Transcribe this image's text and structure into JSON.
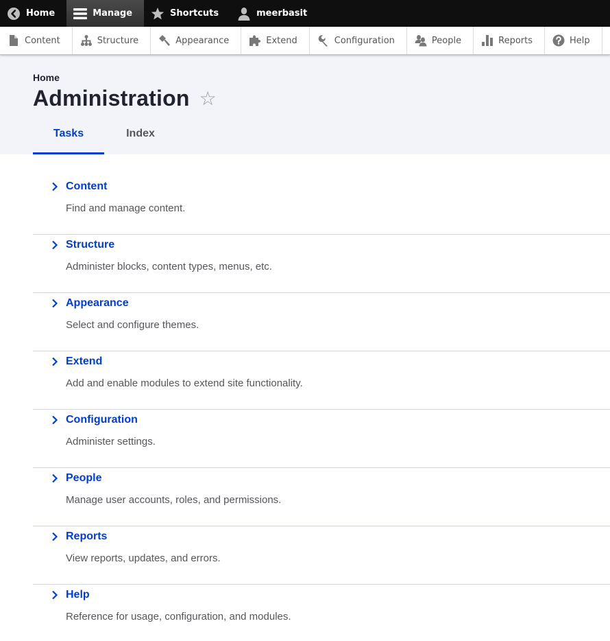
{
  "toolbar": {
    "items": [
      {
        "label": "Home",
        "icon": "back-arrow-circle-icon"
      },
      {
        "label": "Manage",
        "icon": "hamburger-menu-icon",
        "active": true
      },
      {
        "label": "Shortcuts",
        "icon": "star-icon"
      },
      {
        "label": "meerbasit",
        "icon": "user-icon"
      }
    ]
  },
  "tray": {
    "items": [
      {
        "label": "Content",
        "icon": "file-icon"
      },
      {
        "label": "Structure",
        "icon": "sitemap-icon"
      },
      {
        "label": "Appearance",
        "icon": "paintbrush-icon"
      },
      {
        "label": "Extend",
        "icon": "puzzle-icon"
      },
      {
        "label": "Configuration",
        "icon": "wrench-icon"
      },
      {
        "label": "People",
        "icon": "people-icon"
      },
      {
        "label": "Reports",
        "icon": "bar-chart-icon"
      },
      {
        "label": "Help",
        "icon": "question-circle-icon"
      }
    ]
  },
  "header": {
    "breadcrumb": "Home",
    "title": "Administration",
    "star_icon": "☆",
    "tabs": [
      {
        "label": "Tasks",
        "active": true
      },
      {
        "label": "Index",
        "active": false
      }
    ]
  },
  "tasks": [
    {
      "title": "Content",
      "description": "Find and manage content."
    },
    {
      "title": "Structure",
      "description": "Administer blocks, content types, menus, etc."
    },
    {
      "title": "Appearance",
      "description": "Select and configure themes."
    },
    {
      "title": "Extend",
      "description": "Add and enable modules to extend site functionality."
    },
    {
      "title": "Configuration",
      "description": "Administer settings."
    },
    {
      "title": "People",
      "description": "Manage user accounts, roles, and permissions."
    },
    {
      "title": "Reports",
      "description": "View reports, updates, and errors."
    },
    {
      "title": "Help",
      "description": "Reference for usage, configuration, and modules."
    }
  ],
  "colors": {
    "toolbar_bg": "#0f0f0f",
    "link_blue": "#003ecc",
    "header_bg": "#f3f4f9",
    "text_dark": "#222330",
    "text_muted": "#55565b"
  }
}
